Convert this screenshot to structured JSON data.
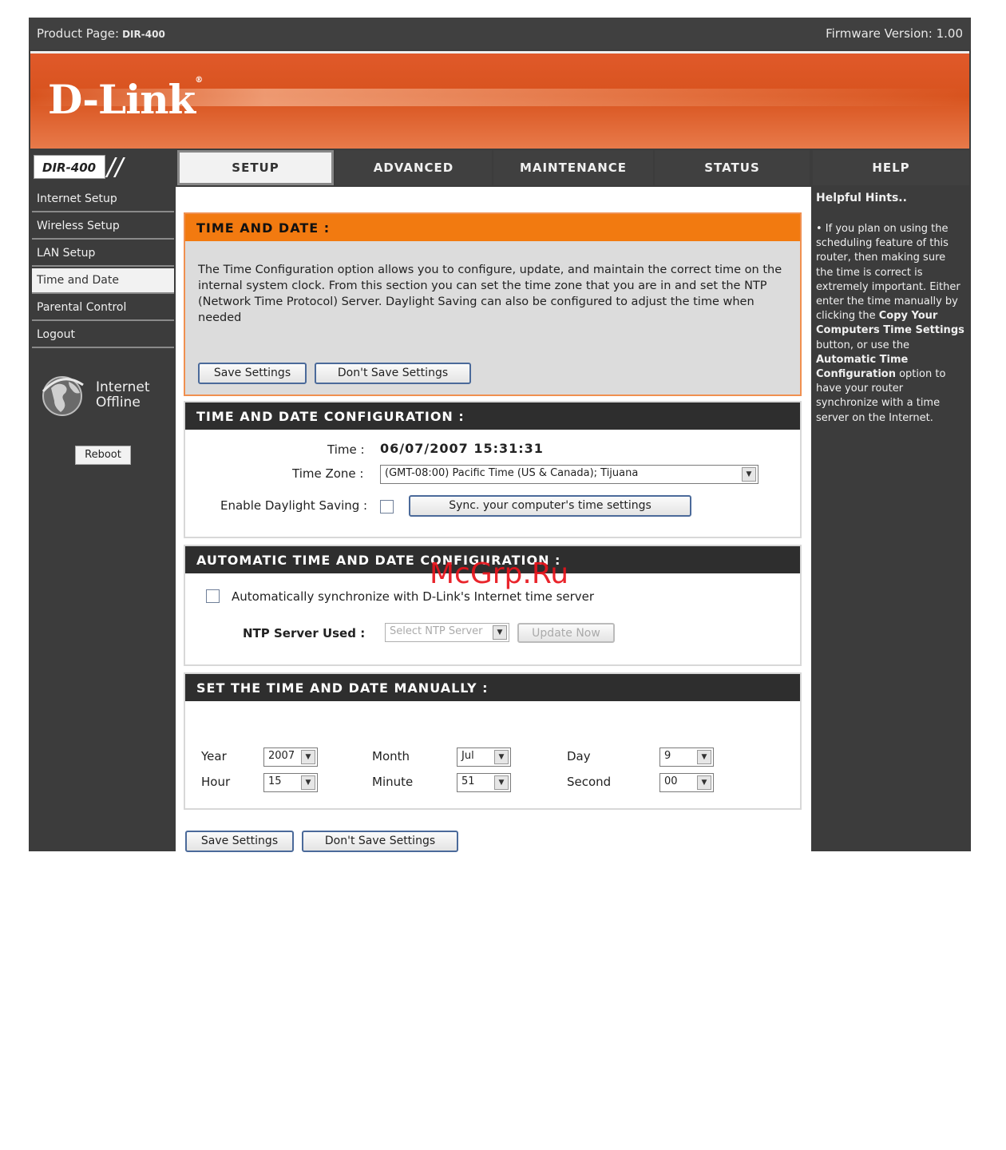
{
  "topbar": {
    "product_label": "Product Page:",
    "model": "DIR-400",
    "firmware": "Firmware Version: 1.00"
  },
  "brand": {
    "logo": "D-Link"
  },
  "nav": {
    "model_badge": "DIR-400",
    "tabs": [
      {
        "label": "SETUP"
      },
      {
        "label": "ADVANCED"
      },
      {
        "label": "MAINTENANCE"
      },
      {
        "label": "STATUS"
      },
      {
        "label": "HELP"
      }
    ]
  },
  "sidebar": {
    "items": [
      {
        "label": "Internet Setup"
      },
      {
        "label": "Wireless Setup"
      },
      {
        "label": "LAN Setup"
      },
      {
        "label": "Time and Date"
      },
      {
        "label": "Parental Control"
      },
      {
        "label": "Logout"
      }
    ],
    "status_line1": "Internet",
    "status_line2": "Offline",
    "reboot_label": "Reboot"
  },
  "time_date": {
    "header": "TIME AND DATE :",
    "description": "The Time Configuration option allows you to configure, update, and maintain the correct time on the internal system clock. From this section you can set the time zone that you are in and set the NTP (Network Time Protocol) Server. Daylight Saving can also be configured to adjust the time when needed",
    "save_label": "Save Settings",
    "dont_save_label": "Don't Save Settings"
  },
  "config": {
    "header": "TIME AND DATE CONFIGURATION :",
    "time_label": "Time :",
    "time_value": "06/07/2007 15:31:31",
    "zone_label": "Time Zone :",
    "zone_value": "(GMT-08:00) Pacific Time (US & Canada); Tijuana",
    "dst_label": "Enable Daylight Saving :",
    "sync_label": "Sync. your computer's time settings"
  },
  "auto": {
    "header": "AUTOMATIC TIME AND DATE CONFIGURATION :",
    "sync_label": "Automatically synchronize with D-Link's Internet time server",
    "ntp_label": "NTP Server Used :",
    "ntp_value": "Select NTP Server",
    "update_label": "Update Now"
  },
  "manual": {
    "header": "SET THE TIME AND DATE MANUALLY :",
    "year_label": "Year",
    "year_value": "2007",
    "month_label": "Month",
    "month_value": "Jul",
    "day_label": "Day",
    "day_value": "9",
    "hour_label": "Hour",
    "hour_value": "15",
    "minute_label": "Minute",
    "minute_value": "51",
    "second_label": "Second",
    "second_value": "00"
  },
  "footer_buttons": {
    "save_label": "Save Settings",
    "dont_save_label": "Don't Save Settings"
  },
  "help": {
    "title": "Helpful Hints..",
    "text_1": "• If you plan on using the scheduling feature of this router, then making sure the time is correct is extremely important. Either enter the time manually by clicking the ",
    "bold_1": "Copy Your Computers Time Settings",
    "text_2": " button, or use the ",
    "bold_2": "Automatic Time Configuration",
    "text_3": " option to have your router synchronize with a time server on the Internet."
  },
  "watermark": "McGrp.Ru",
  "colors": {
    "accent_orange": "#f27a10",
    "banner": "#d8531e",
    "dark": "#3c3c3c",
    "button_border": "#4b6a9a"
  }
}
